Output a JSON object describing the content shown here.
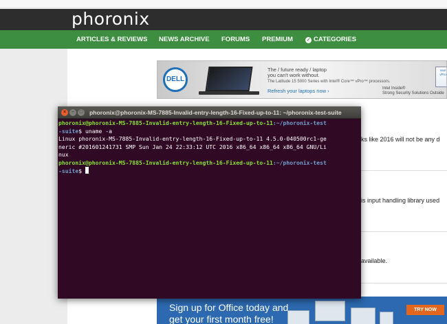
{
  "site": {
    "logo": "phoronix",
    "nav": [
      {
        "label": "ARTICLES & REVIEWS"
      },
      {
        "label": "NEWS ARCHIVE"
      },
      {
        "label": "FORUMS"
      },
      {
        "label": "PREMIUM"
      },
      {
        "label": "CATEGORIES"
      }
    ]
  },
  "ads": {
    "dell": {
      "logo": "DELL",
      "line1": "The / future ready / laptop",
      "line2": "you can't work without.",
      "line3": "The Latitude 15 5000 Series with Intel® Core™ vPro™ processors.",
      "cta": "Refresh your laptops now ›",
      "intel1": "Intel Inside®",
      "intel2": "Strong Security Solutions Outside"
    },
    "office": {
      "line1": "Sign up for Office today and",
      "line2": "get your first month free!",
      "button": "TRY NOW"
    }
  },
  "snippets": [
    {
      "text": "ks like 2016 will not be any d"
    },
    {
      "text": "is input handling library used"
    },
    {
      "text": "available."
    }
  ],
  "terminal": {
    "title": "phoronix@phoronix-MS-7885-Invalid-entry-length-16-Fixed-up-to-11: ~/phoronix-test-suite",
    "prompt_user": "phoronix@phoronix-MS-7885-Invalid-entry-length-16-Fixed-up-to-11",
    "prompt_path": ":~/phoronix-test",
    "prompt_path_cont": "-suite",
    "prompt_symbol": "$ ",
    "command": "uname -a",
    "output": [
      "Linux phoronix-MS-7885-Invalid-entry-length-16-Fixed-up-to-11 4.5.0-040500rc1-ge",
      "neric #201601241731 SMP Sun Jan 24 22:33:12 UTC 2016 x86_64 x86_64 x86_64 GNU/Li",
      "nux"
    ]
  },
  "colors": {
    "nav_green": "#3e8e41",
    "header_dark": "#2d2d2d",
    "terminal_bg": "#300a24",
    "prompt_green": "#8ae234",
    "prompt_blue": "#729fcf"
  }
}
